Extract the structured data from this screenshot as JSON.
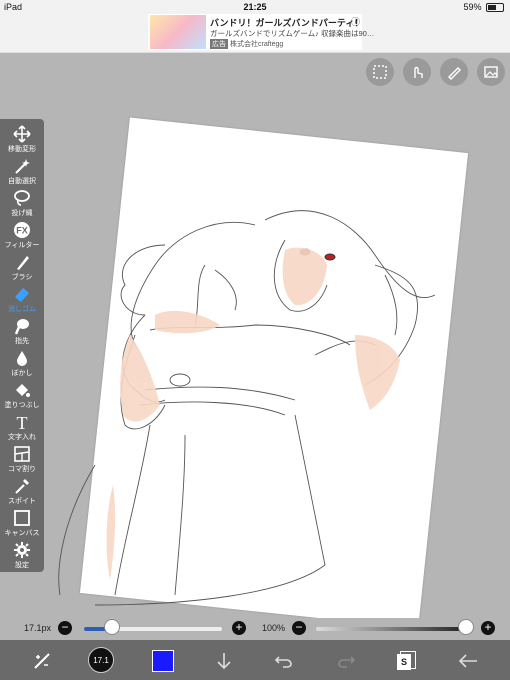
{
  "status_bar": {
    "device": "iPad",
    "time": "21:25",
    "battery": "59%",
    "battery_level": 0.59
  },
  "ad": {
    "title": "バンドリ！ガールズバンドパーティ！",
    "description": "ガールズバンドでリズムゲーム♪ 収録楽曲は90…",
    "tag": "広告",
    "company": "株式会社craftegg",
    "info": "ⓘ"
  },
  "top_tools": [
    {
      "icon": "selection-icon"
    },
    {
      "icon": "touch-icon"
    },
    {
      "icon": "pen-icon"
    },
    {
      "icon": "image-icon"
    }
  ],
  "left_tools": [
    {
      "icon": "move-icon",
      "label": "移動変形"
    },
    {
      "icon": "magic-wand-icon",
      "label": "自動選択"
    },
    {
      "icon": "lasso-icon",
      "label": "投げ縄"
    },
    {
      "icon": "filter-icon",
      "label": "フィルター",
      "glyph": "FX"
    },
    {
      "icon": "brush-icon",
      "label": "ブラシ"
    },
    {
      "icon": "eraser-icon",
      "label": "消しゴム",
      "active": true
    },
    {
      "icon": "finger-icon",
      "label": "指先"
    },
    {
      "icon": "blur-icon",
      "label": "ぼかし"
    },
    {
      "icon": "bucket-icon",
      "label": "塗りつぶし"
    },
    {
      "icon": "text-icon",
      "label": "文字入れ",
      "glyph": "T"
    },
    {
      "icon": "frame-icon",
      "label": "コマ割り"
    },
    {
      "icon": "eyedropper-icon",
      "label": "スポイト"
    },
    {
      "icon": "canvas-icon",
      "label": "キャンバス"
    },
    {
      "icon": "settings-icon",
      "label": "設定"
    }
  ],
  "sliders": {
    "brush_size": {
      "label": "17.1px",
      "value": 17.1,
      "fraction": 0.2
    },
    "opacity": {
      "label": "100%",
      "value": 100,
      "fraction": 1.0
    },
    "minus": "−",
    "plus": "+"
  },
  "bottom_toolbar": {
    "brush_size_badge": "17.1",
    "current_color": "#1a1aff",
    "layers_label": "S",
    "items": [
      "adjust-icon",
      "brush-size-icon",
      "color-swatch",
      "download-icon",
      "undo-icon",
      "redo-icon",
      "layers-icon",
      "back-icon"
    ]
  },
  "colors": {
    "accent": "#3aa0ff",
    "toolbar": "#6a6a6a",
    "workspace": "#b5b5b5"
  }
}
